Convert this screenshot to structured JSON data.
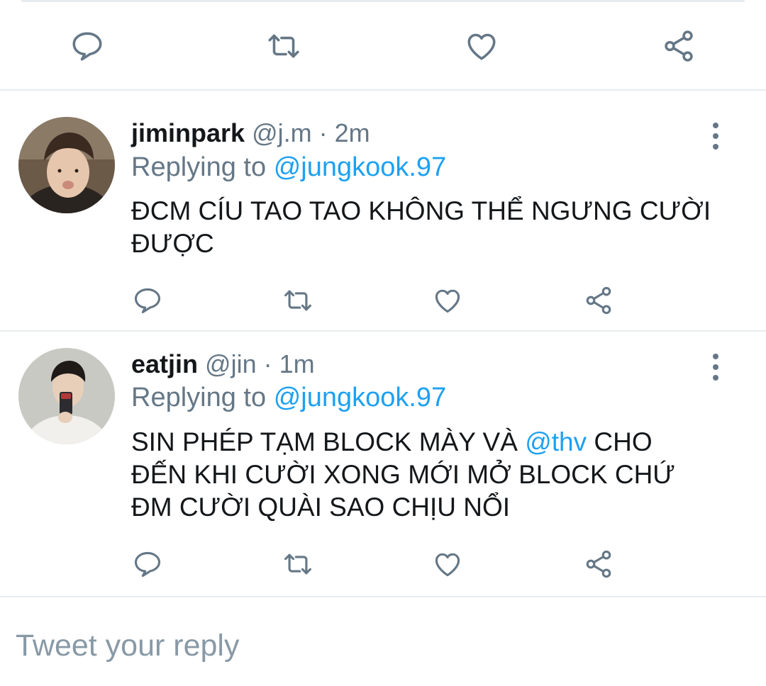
{
  "colors": {
    "icon": "#657786",
    "accent": "#1da1f2",
    "divider": "#e6ecf0",
    "text": "#14171a",
    "muted": "#657786",
    "placeholder": "#8899a6"
  },
  "main_actions": {
    "icons": [
      "reply-icon",
      "retweet-icon",
      "like-icon",
      "share-icon"
    ]
  },
  "replies": [
    {
      "name": "jiminpark",
      "handle": "@j.m",
      "separator": "·",
      "time": "2m",
      "replying_label": "Replying to",
      "replying_to": "@jungkook.97",
      "text_lines": [
        "ĐCM CÍU TAO TAO KHÔNG THỂ NGƯNG CƯỜI",
        "ĐƯỢC"
      ]
    },
    {
      "name": "eatjin",
      "handle": "@jin",
      "separator": "·",
      "time": "1m",
      "replying_label": "Replying to",
      "replying_to": "@jungkook.97",
      "text_line1_before": "SIN PHÉP TẠM BLOCK MÀY VÀ ",
      "text_line1_mention": "@thv",
      "text_line1_after": " CHO",
      "text_lines": [
        "ĐẾN KHI CƯỜI XONG MỚI MỞ BLOCK CHỨ",
        "ĐM CƯỜI QUÀI SAO CHỊU NỔI"
      ]
    }
  ],
  "compose": {
    "placeholder": "Tweet your reply"
  }
}
